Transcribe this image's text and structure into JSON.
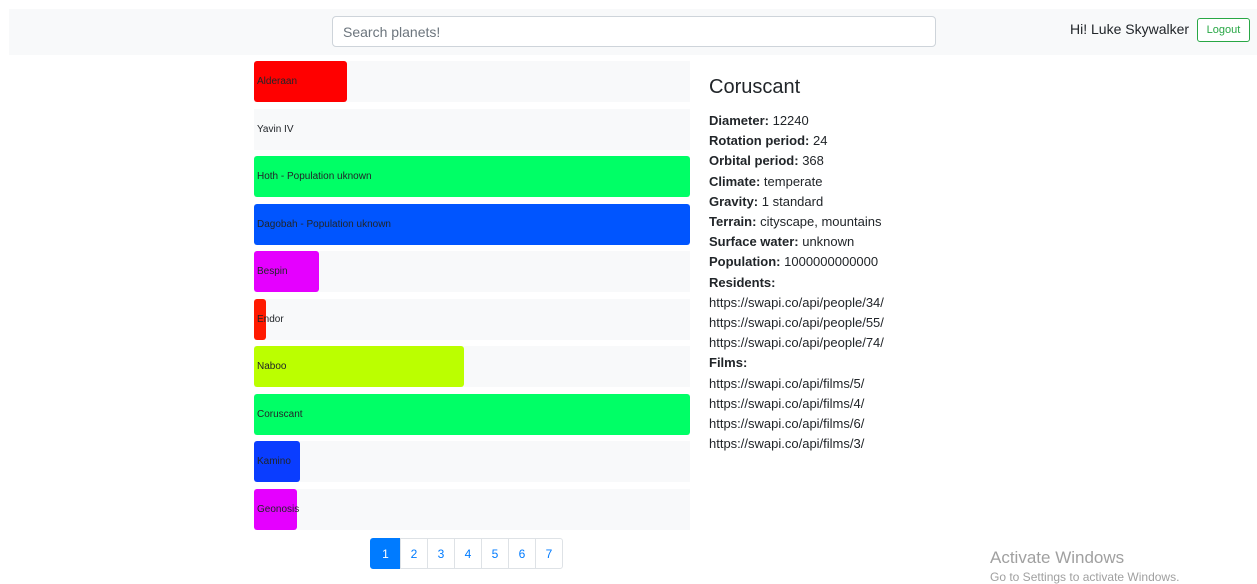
{
  "header": {
    "search_placeholder": "Search planets!",
    "greeting": "Hi! Luke Skywalker",
    "logout_label": "Logout"
  },
  "planets": [
    {
      "label": "Alderaan",
      "bar_fraction": 0.214,
      "color": "#ff0000"
    },
    {
      "label": "Yavin IV",
      "bar_fraction": 0.0,
      "color": "#ffffff"
    },
    {
      "label": "Hoth - Population uknown",
      "bar_fraction": 1.0,
      "color": "#00ff66"
    },
    {
      "label": "Dagobah - Population uknown",
      "bar_fraction": 1.0,
      "color": "#0055ff"
    },
    {
      "label": "Bespin",
      "bar_fraction": 0.149,
      "color": "#e500ff"
    },
    {
      "label": "Endor",
      "bar_fraction": 0.028,
      "color": "#ff1a00"
    },
    {
      "label": "Naboo",
      "bar_fraction": 0.482,
      "color": "#bbff00"
    },
    {
      "label": "Coruscant",
      "bar_fraction": 1.0,
      "color": "#00ff66"
    },
    {
      "label": "Kamino",
      "bar_fraction": 0.105,
      "color": "#0a3dff"
    },
    {
      "label": "Geonosis",
      "bar_fraction": 0.099,
      "color": "#e500ff"
    }
  ],
  "pagination": {
    "pages": [
      "1",
      "2",
      "3",
      "4",
      "5",
      "6",
      "7"
    ],
    "active": "1"
  },
  "details": {
    "name": "Coruscant",
    "fields": [
      {
        "label": "Diameter:",
        "value": "12240"
      },
      {
        "label": "Rotation period:",
        "value": "24"
      },
      {
        "label": "Orbital period:",
        "value": "368"
      },
      {
        "label": "Climate:",
        "value": "temperate"
      },
      {
        "label": "Gravity:",
        "value": "1 standard"
      },
      {
        "label": "Terrain:",
        "value": "cityscape, mountains"
      },
      {
        "label": "Surface water:",
        "value": "unknown"
      },
      {
        "label": "Population:",
        "value": "1000000000000"
      }
    ],
    "residents_label": "Residents:",
    "residents": [
      "https://swapi.co/api/people/34/",
      "https://swapi.co/api/people/55/",
      "https://swapi.co/api/people/74/"
    ],
    "films_label": "Films:",
    "films": [
      "https://swapi.co/api/films/5/",
      "https://swapi.co/api/films/4/",
      "https://swapi.co/api/films/6/",
      "https://swapi.co/api/films/3/"
    ]
  },
  "watermark": {
    "title": "Activate Windows",
    "subtitle": "Go to Settings to activate Windows."
  }
}
